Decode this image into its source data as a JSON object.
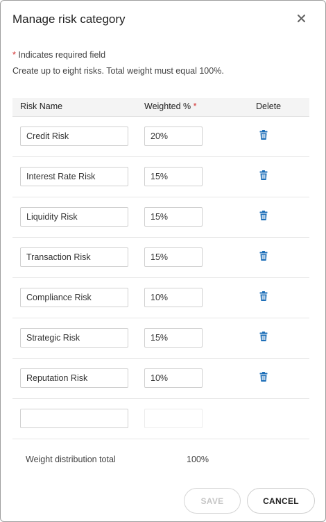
{
  "dialog": {
    "title": "Manage risk category",
    "required_star": "*",
    "required_note": "Indicates required field",
    "info_note": "Create up to eight risks. Total weight must equal 100%."
  },
  "table": {
    "headers": {
      "risk_name": "Risk Name",
      "weighted": "Weighted %",
      "weighted_star": "*",
      "delete": "Delete"
    },
    "rows": [
      {
        "name": "Credit Risk",
        "weight": "20%"
      },
      {
        "name": "Interest Rate Risk",
        "weight": "15%"
      },
      {
        "name": "Liquidity Risk",
        "weight": "15%"
      },
      {
        "name": "Transaction Risk",
        "weight": "15%"
      },
      {
        "name": "Compliance Risk",
        "weight": "10%"
      },
      {
        "name": "Strategic Risk",
        "weight": "15%"
      },
      {
        "name": "Reputation Risk",
        "weight": "10%"
      }
    ],
    "empty_row": {
      "name": "",
      "weight": ""
    }
  },
  "summary": {
    "total_label": "Weight distribution total",
    "total_value": "100%"
  },
  "buttons": {
    "save": "SAVE",
    "cancel": "CANCEL"
  },
  "icons": {
    "close": "close-icon",
    "delete": "trash-icon"
  },
  "colors": {
    "required_star": "#d32f2f",
    "delete_icon": "#1e6fb8",
    "save_disabled_text": "#c6c6c6"
  }
}
